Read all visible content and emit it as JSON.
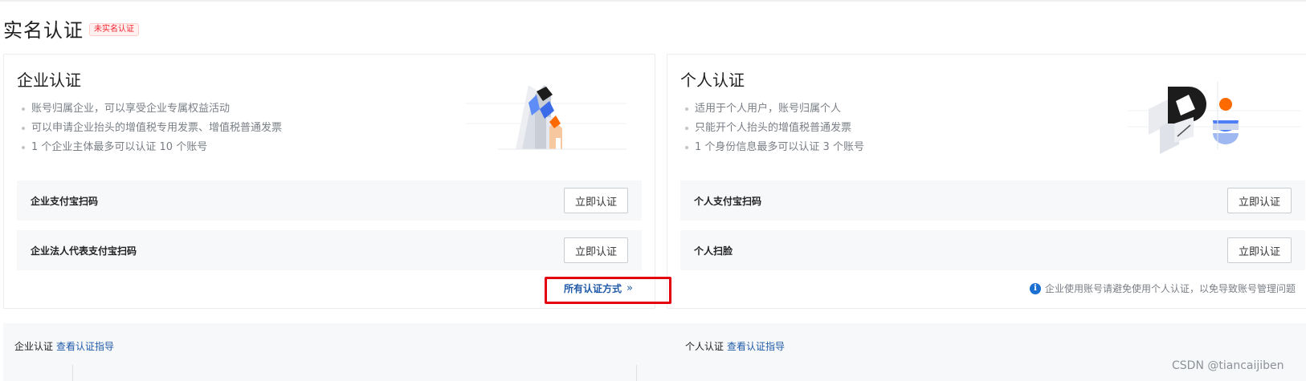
{
  "page": {
    "title": "实名认证",
    "status_badge": "未实名认证"
  },
  "enterprise": {
    "title": "企业认证",
    "bullets": [
      "账号归属企业，可以享受企业专属权益活动",
      "可以申请企业抬头的增值税专用发票、增值税普通发票",
      "1 个企业主体最多可以认证 10 个账号"
    ],
    "methods": [
      {
        "label": "企业支付宝扫码",
        "button": "立即认证"
      },
      {
        "label": "企业法人代表支付宝扫码",
        "button": "立即认证"
      }
    ],
    "all_methods_link": "所有认证方式",
    "illustration_icon": "buildings-illustration"
  },
  "personal": {
    "title": "个人认证",
    "bullets": [
      "适用于个人用户，账号归属个人",
      "只能开个人抬头的增值税普通发票",
      "1 个身份信息最多可以认证 3 个账号"
    ],
    "methods": [
      {
        "label": "个人支付宝扫码",
        "button": "立即认证"
      },
      {
        "label": "个人扫脸",
        "button": "立即认证"
      }
    ],
    "notice": "企业使用账号请避免使用个人认证，以免导致账号管理问题",
    "illustration_icon": "person-illustration"
  },
  "bottom": {
    "enterprise_label": "企业认证",
    "enterprise_guide": "查看认证指导",
    "personal_label": "个人认证",
    "personal_guide": "查看认证指导"
  },
  "watermark": "CSDN @tiancaijiben",
  "colors": {
    "link": "#1f5aa8",
    "badge_red": "#f5222d",
    "highlight_red": "#e3000f",
    "info_blue": "#1b6fd1",
    "accent_orange": "#ff6a00",
    "accent_blue": "#4f7ef7"
  }
}
